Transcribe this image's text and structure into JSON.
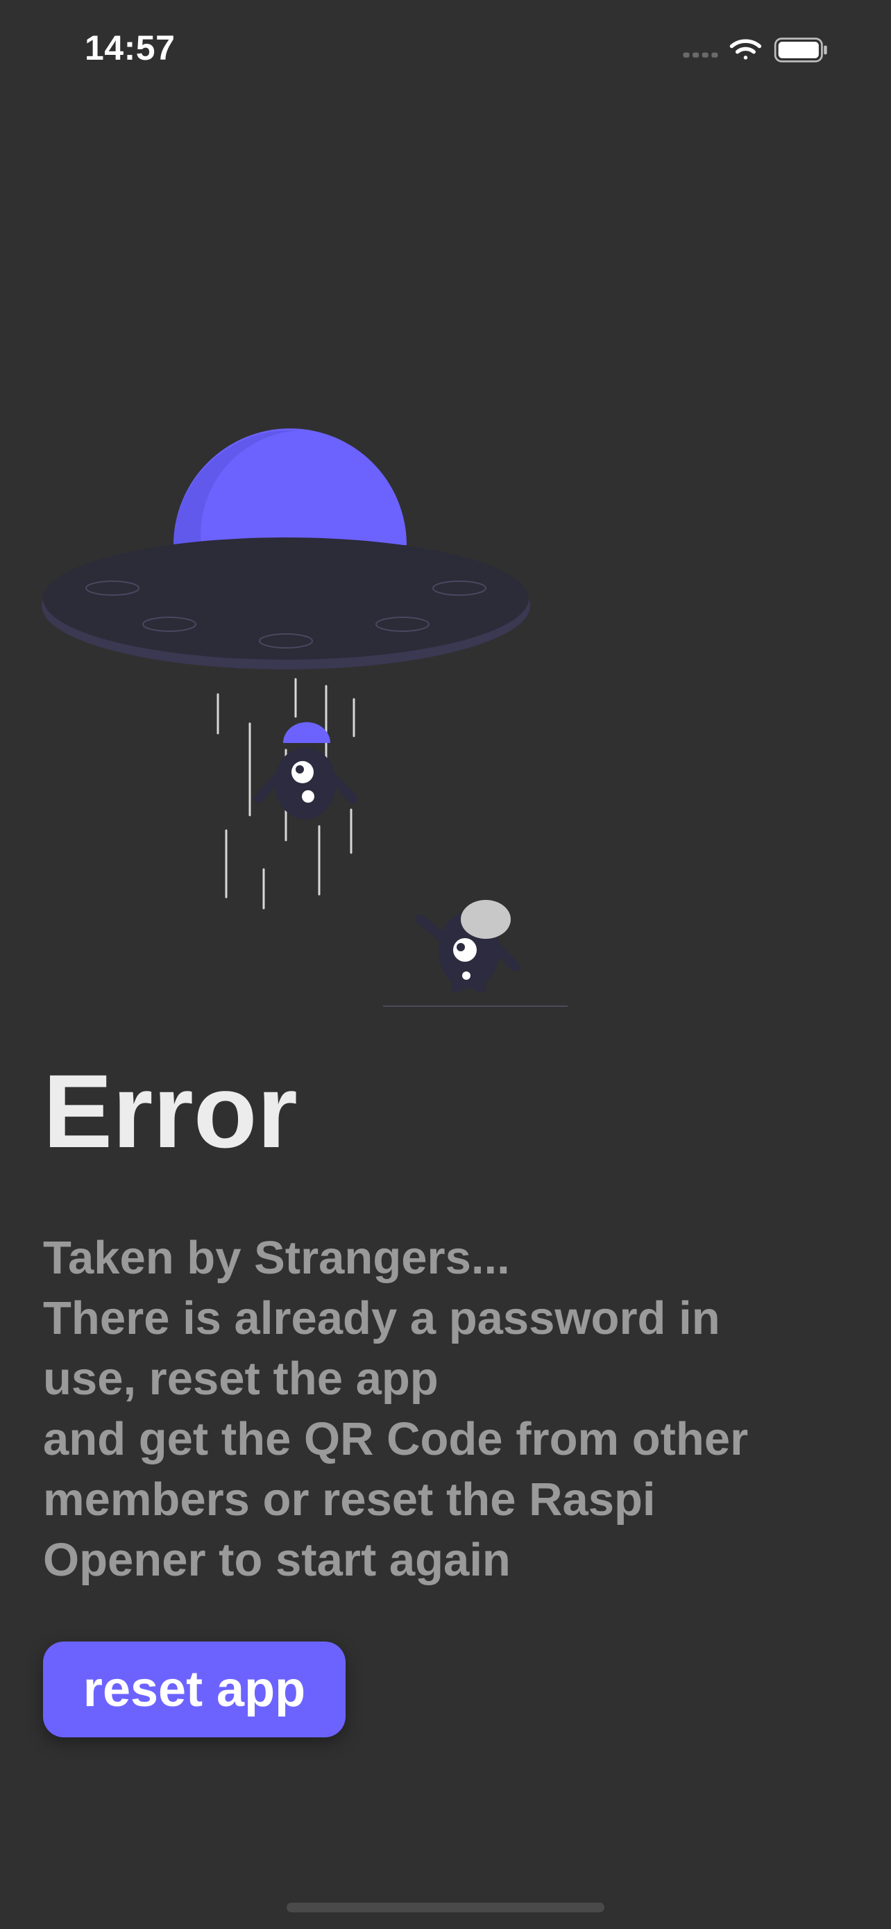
{
  "status_bar": {
    "time": "14:57",
    "signal_icon": "signal-dots-icon",
    "wifi_icon": "wifi-icon",
    "battery_icon": "battery-icon"
  },
  "illustration": {
    "name": "ufo-abduction-illustration",
    "accent_color": "#6c63ff"
  },
  "error": {
    "title": "Error",
    "lines": [
      "Taken by Strangers...",
      "There is already a password in",
      "use, reset the app",
      "and get the QR Code from other",
      "members or reset the Raspi",
      "Opener to start again"
    ]
  },
  "actions": {
    "reset_label": "reset app"
  },
  "colors": {
    "background": "#303030",
    "accent": "#6c63ff",
    "title": "#ececec",
    "message": "#9a9a9a"
  }
}
